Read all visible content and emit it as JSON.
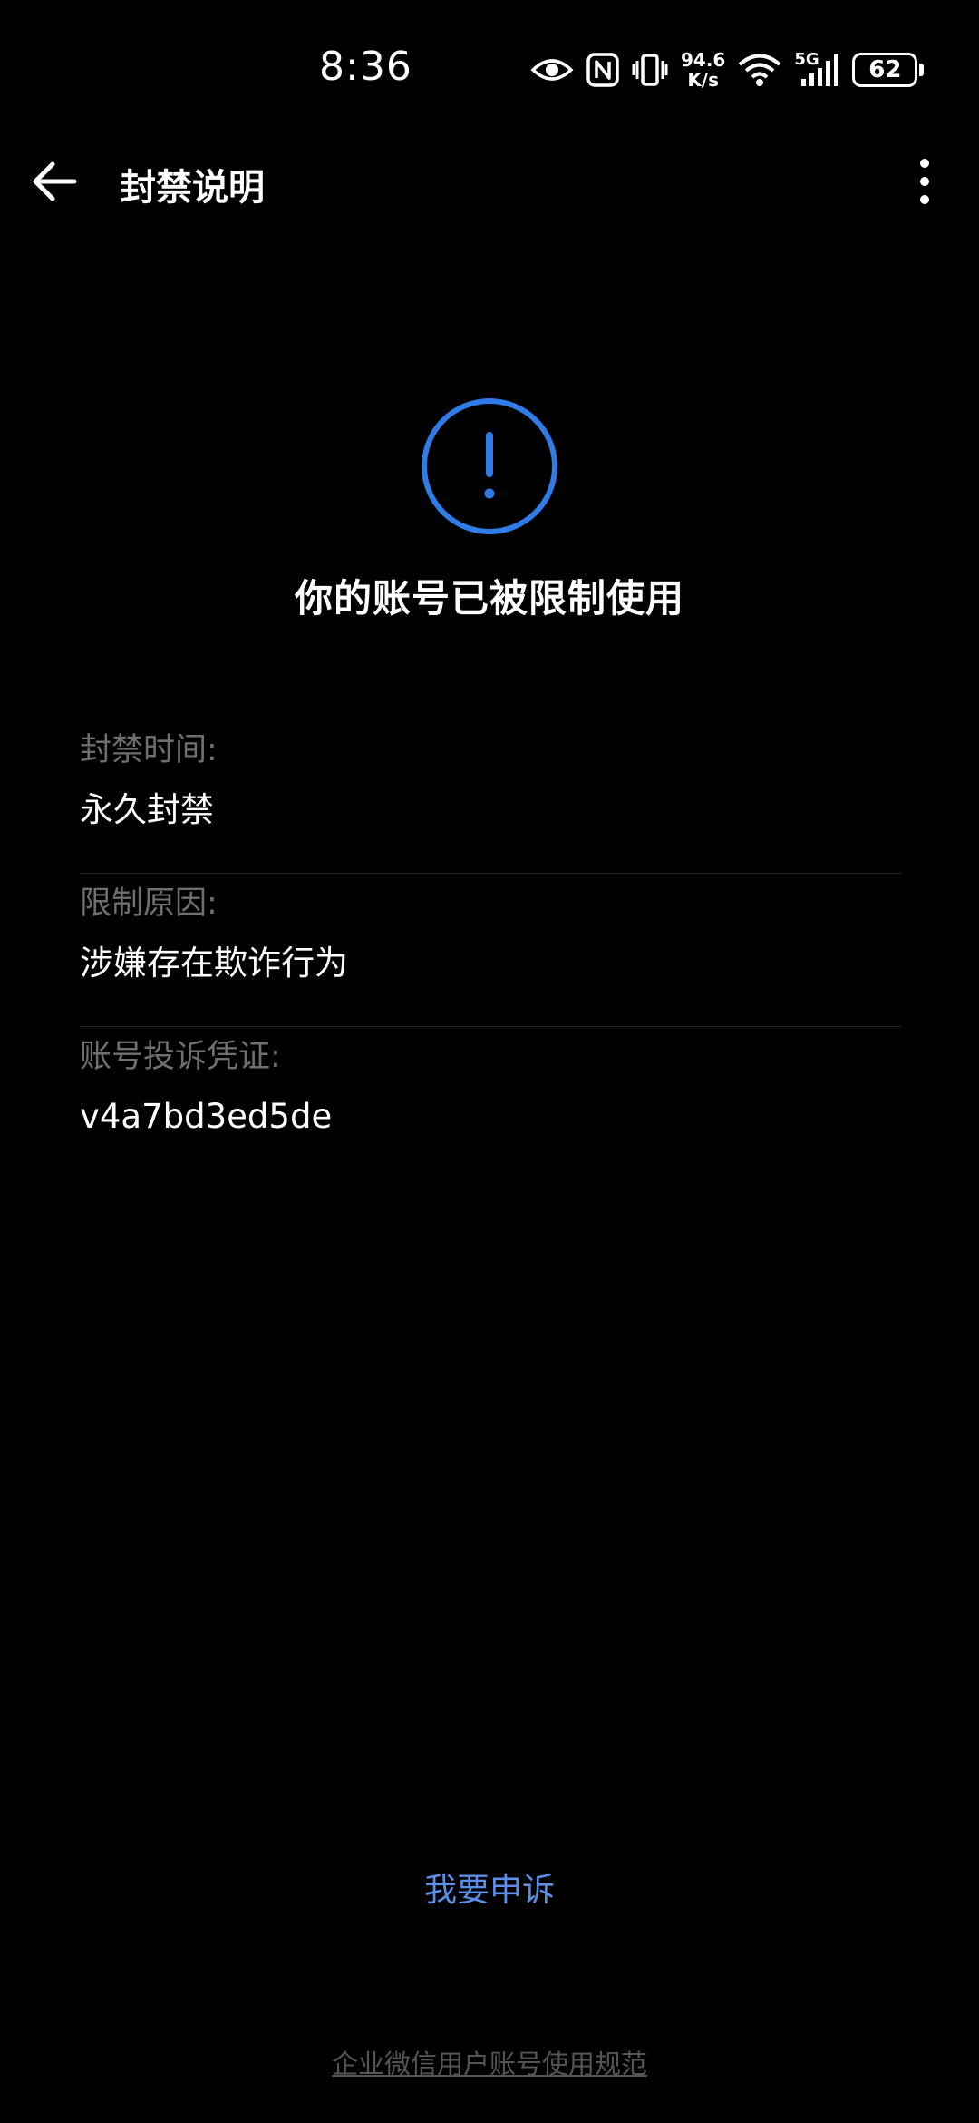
{
  "status_bar": {
    "time": "8:36",
    "net_speed_value": "94.6",
    "net_speed_unit": "K/s",
    "network_type": "5G",
    "battery_level": "62"
  },
  "app_bar": {
    "title": "封禁说明"
  },
  "notice": {
    "headline": "你的账号已被限制使用",
    "accent_color": "#2f7be8"
  },
  "info": {
    "items": [
      {
        "label": "封禁时间:",
        "value": "永久封禁"
      },
      {
        "label": "限制原因:",
        "value": "涉嫌存在欺诈行为"
      },
      {
        "label": "账号投诉凭证:",
        "value": "v4a7bd3ed5de"
      }
    ]
  },
  "actions": {
    "appeal_label": "我要申诉",
    "policy_link": "企业微信用户账号使用规范"
  }
}
